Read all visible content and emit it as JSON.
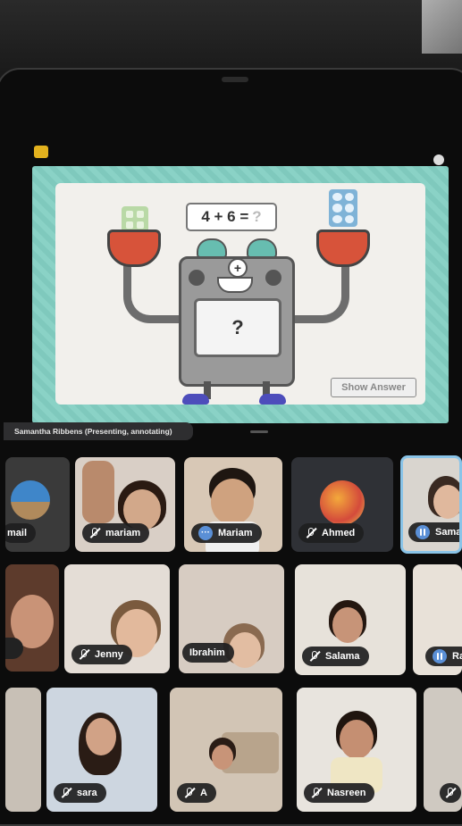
{
  "slide": {
    "equation": "4 + 6 =",
    "equation_unknown": "?",
    "robot_screen_value": "?",
    "plus_symbol": "+",
    "show_answer_label": "Show Answer"
  },
  "presenter": {
    "label": "Samantha Ribbens (Presenting, annotating)"
  },
  "participants": [
    {
      "name": "mail",
      "status": "none"
    },
    {
      "name": "mariam",
      "status": "muted"
    },
    {
      "name": "Mariam",
      "status": "more"
    },
    {
      "name": "Ahmed",
      "status": "muted"
    },
    {
      "name": "Sama",
      "status": "speaking"
    },
    {
      "name": "",
      "status": "none"
    },
    {
      "name": "Jenny",
      "status": "muted"
    },
    {
      "name": "Ibrahim",
      "status": "none"
    },
    {
      "name": "Salama",
      "status": "muted"
    },
    {
      "name": "Ra",
      "status": "speaking"
    },
    {
      "name": "sara",
      "status": "muted"
    },
    {
      "name": "A",
      "status": "muted"
    },
    {
      "name": "Nasreen",
      "status": "muted"
    }
  ],
  "colors": {
    "share_border": "#7fc9bd",
    "robot_hand": "#d7533a",
    "active_tile_border": "#8ac4e8",
    "speaking_indicator": "#5a8fd6"
  }
}
